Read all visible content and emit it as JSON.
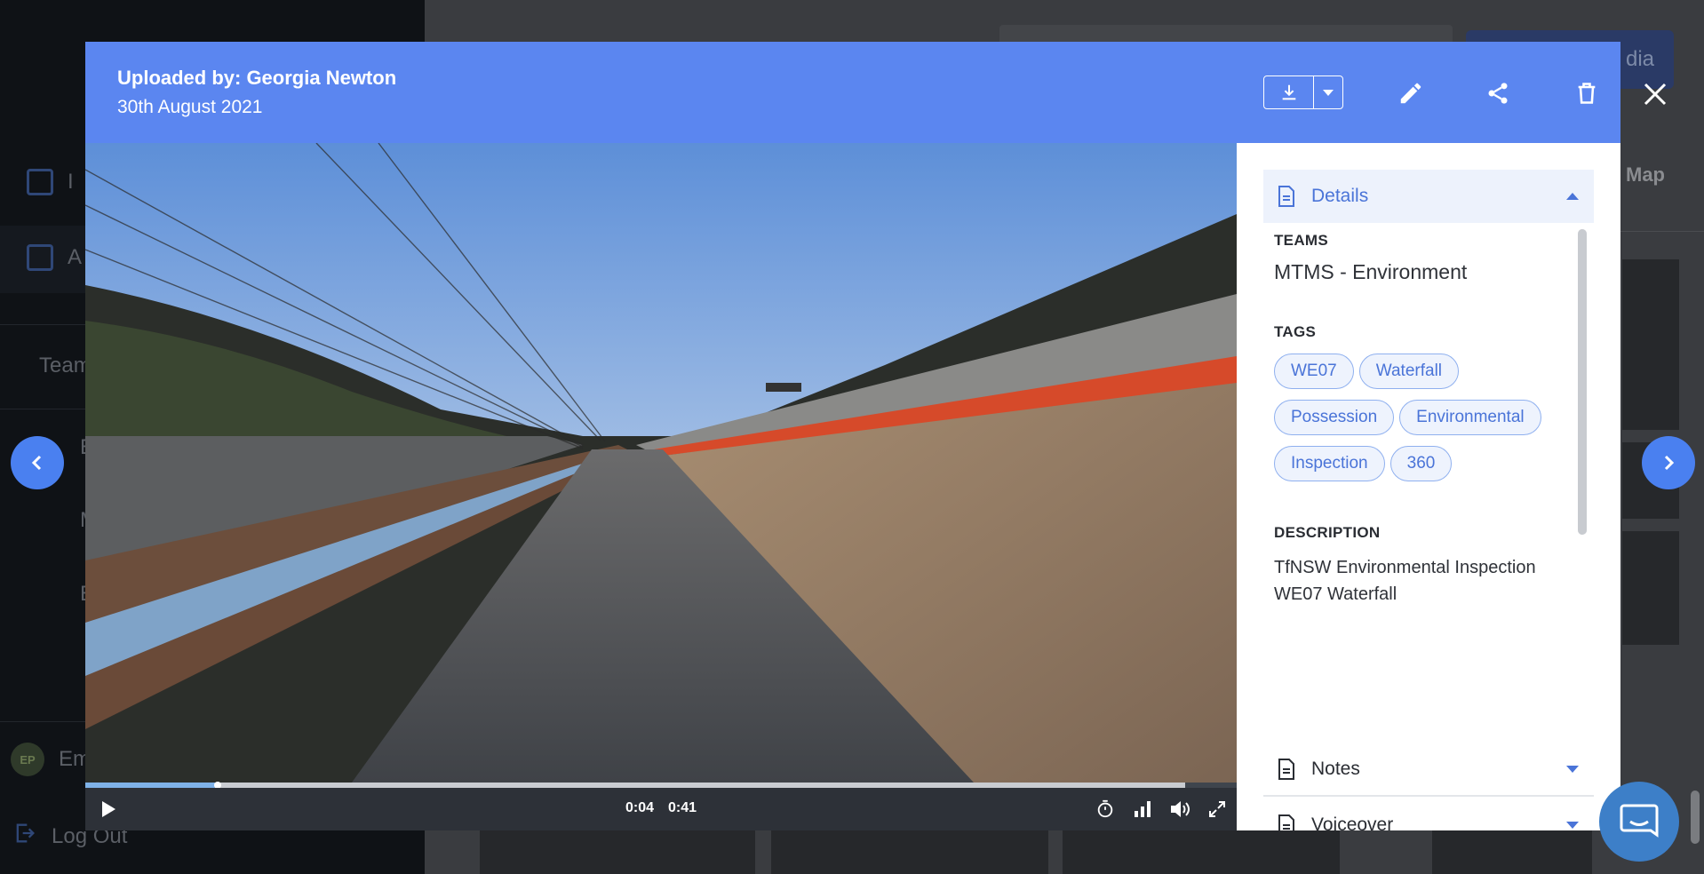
{
  "background": {
    "sidebar": {
      "items": [
        {
          "label": "I",
          "icon": "profile-icon"
        },
        {
          "label": "A",
          "icon": "gallery-icon"
        }
      ],
      "teams_label": "Team",
      "sub_items": [
        "E",
        "M",
        "E"
      ],
      "user": {
        "initials": "EP",
        "name": "Em"
      },
      "logout_label": "Log Out"
    },
    "top_button_label": "dia",
    "tab_map_label": "Map"
  },
  "modal": {
    "uploader": "Uploaded by: Georgia Newton",
    "date": "30th August 2021",
    "toolbar": {
      "download_icon": "download-icon",
      "download_menu_icon": "chevron-down-icon",
      "edit_icon": "pencil-icon",
      "share_icon": "share-icon",
      "delete_icon": "trash-icon"
    },
    "video": {
      "current_time": "0:04",
      "duration": "0:41",
      "played_fraction": 0.115,
      "buffered_fraction": 0.955
    },
    "panel": {
      "details": {
        "title": "Details",
        "teams_label": "TEAMS",
        "team": "MTMS - Environment",
        "tags_label": "TAGS",
        "tags": [
          "WE07",
          "Waterfall",
          "Possession",
          "Environmental",
          "Inspection",
          "360"
        ],
        "description_label": "DESCRIPTION",
        "description_line1": "TfNSW Environmental Inspection",
        "description_line2": "WE07 Waterfall"
      },
      "notes_title": "Notes",
      "voiceover_title": "Voiceover"
    }
  },
  "colors": {
    "header_blue": "#5b86f0",
    "accent_blue": "#4a74d8",
    "tag_border": "#8fb0ef",
    "controls_bg": "#2d3138"
  }
}
